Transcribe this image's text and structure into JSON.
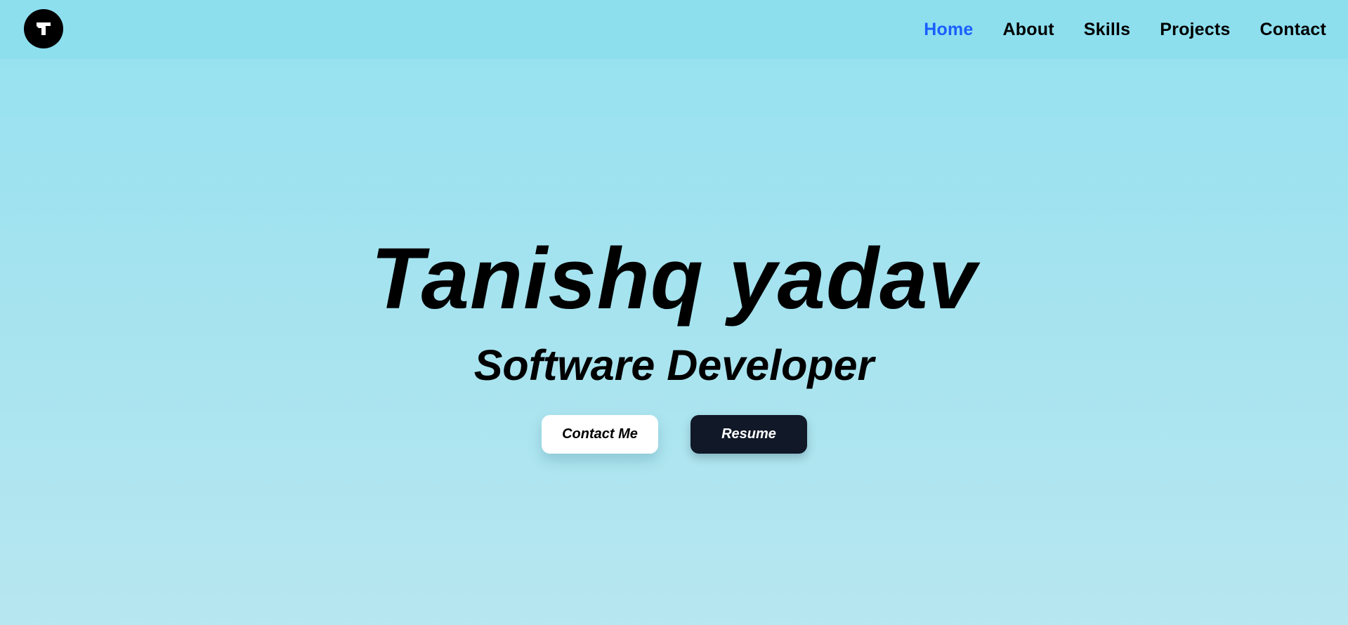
{
  "nav": {
    "logo_icon": "t-logo-icon",
    "links": [
      {
        "label": "Home",
        "active": true
      },
      {
        "label": "About",
        "active": false
      },
      {
        "label": "Skills",
        "active": false
      },
      {
        "label": "Projects",
        "active": false
      },
      {
        "label": "Contact",
        "active": false
      }
    ]
  },
  "hero": {
    "name": "Tanishq yadav",
    "role": "Software Developer",
    "buttons": {
      "contact_label": "Contact Me",
      "resume_label": "Resume"
    }
  },
  "colors": {
    "accent": "#1a5fff",
    "nav_background": "#8ddfee",
    "dark_button": "#111827",
    "light_button": "#ffffff"
  }
}
